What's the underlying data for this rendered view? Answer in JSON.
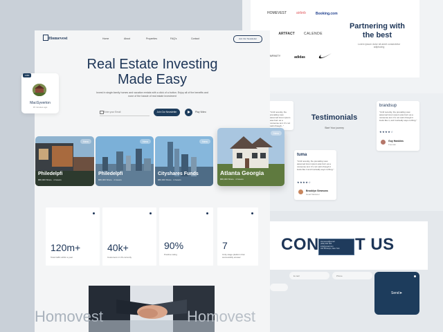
{
  "partners": {
    "logos": [
      "HOMEVEST",
      "airbnb",
      "Booking.com",
      "ARTFACT",
      "CALENDE",
      "INFINITY",
      "adidas",
      "nike"
    ],
    "title": "Partnering with the best",
    "subtitle": "Lorem ipsum dolor sit amet consectetur adipiscing"
  },
  "testimonials": {
    "title": "Testimonials",
    "subtitle": "Start Your journey",
    "cards": [
      {
        "brand": "brandsup",
        "quote": "\"Until recently, the prevailing view assumed lorem ipsum was born as a nonsense text. It's not Latin though it looks like it, and it actually says nothing.\"",
        "stars": "★★★★☆",
        "name": "Guy Hawkins",
        "role": "Founder"
      },
      {
        "brand": "tuma",
        "quote": "\"Until recently, the prevailing view assumed lorem ipsum was born as a nonsense text. It's not Latin though it looks like it and it actually says nothing.\"",
        "stars": "★★★★☆",
        "name": "Brooklyn Simmons",
        "role": "Head Marketer"
      },
      {
        "brand": "",
        "quote": "\"Until recently, the prevailing view assumed lorem ipsum was born as a nonsense text. It's not Latin though...\"",
        "stars": "",
        "name": "",
        "role": ""
      }
    ]
  },
  "contact": {
    "title_left": "CON",
    "title_right": "T US",
    "card_lines": [
      "Homevest@email",
      "(000) 000 000",
      "info@gmail.com",
      "321 Brooklyn, New York"
    ],
    "inputs": [
      "E-mail",
      "Phone"
    ],
    "send_label": "Send"
  },
  "nav": {
    "logo": "Homevest",
    "links": [
      "Home",
      "About",
      "Properties",
      "FAQ's",
      "Contact"
    ],
    "cta": "Join Our Newsletter"
  },
  "hero": {
    "title": "Real Estate Investing Made Easy",
    "subtitle": "Invest in single-family homes and vacation rentals with a click of a button. Enjoy all of the benefits and none of the hassle of real estate investment",
    "email_placeholder": "Enter your Email",
    "cta": "Join Our Newsletter",
    "play_label": "Play Video"
  },
  "profile": {
    "badge": "1480",
    "name": "MacGyverton",
    "meta": "15 minutes ago"
  },
  "properties": [
    {
      "title": "Philedelpfi",
      "meta": "$80,000 Share  ·  2 Assets",
      "badge": "New"
    },
    {
      "title": "Philedelpfi",
      "meta": "$80,000 Share  ·  2 Assets",
      "badge": "New"
    },
    {
      "title": "Cityshares Funds",
      "meta": "$80,000 Share  ·  2 Assets",
      "badge": "New"
    },
    {
      "title": "Atlanta Georgia",
      "meta": "$80,000 Share  ·  2 Assets",
      "badge": "New"
    }
  ],
  "stats": [
    {
      "value": "120m+",
      "label": "Total traffic within a year"
    },
    {
      "value": "40k+",
      "label": "Customers in US currently"
    },
    {
      "value": "90%",
      "label": "Positive rating"
    },
    {
      "value": "7",
      "label": "Unity stage platform that successfully answer"
    }
  ],
  "footer_word": "Homovest",
  "colors": {
    "primary": "#1d3557",
    "accent_dark": "#1d3c5c",
    "background": "#c9d0d8"
  }
}
